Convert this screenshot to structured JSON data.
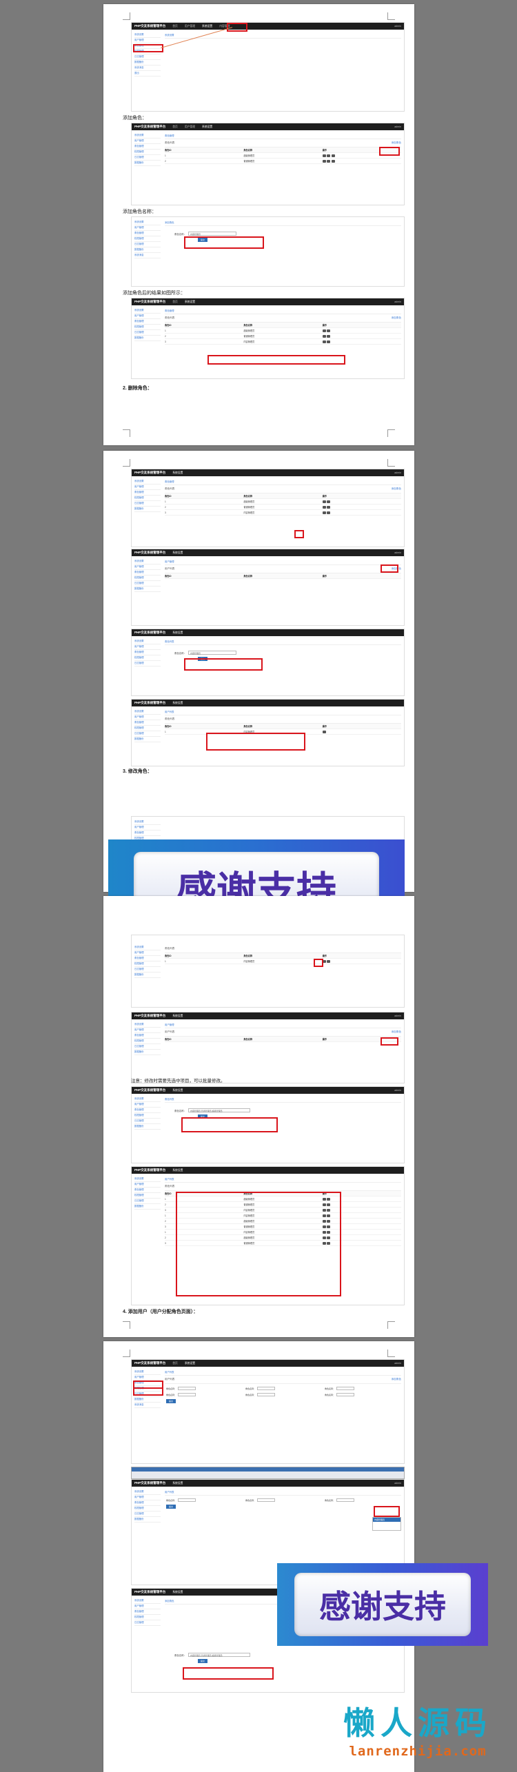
{
  "app": {
    "brand": "PHP交友系统管理平台",
    "nav": [
      "首页",
      "用户管理",
      "系统设置",
      "内容管理",
      "数据统计"
    ],
    "top_right": "admin"
  },
  "sidebar": [
    "系统设置",
    "用户管理",
    "角色管理",
    "权限管理",
    "日志管理",
    "数据备份",
    "系统消息",
    "退出"
  ],
  "table": {
    "headers": [
      "角色ID",
      "角色名称",
      "操作"
    ],
    "rows": [
      {
        "id": "1",
        "name": "超级管理员"
      },
      {
        "id": "2",
        "name": "普通管理员"
      },
      {
        "id": "3",
        "name": "内容管理员"
      }
    ]
  },
  "captions": {
    "c1": "添加角色：",
    "c2": "添加角色名称：",
    "c3": "添加角色后的结果如图所示：",
    "s2": "2.  删除角色：",
    "s3": "3.  修改角色：",
    "note": "注意：修改时需要先选中项目，可以批量修改。",
    "s4": "4.  添加用户（用户分配角色页面）："
  },
  "form": {
    "role_label": "角色名称：",
    "role_value": "内容管理员",
    "submit": "提交",
    "add_link": "添加角色",
    "list_title": "角色列表",
    "user_list": "用户列表",
    "edit_value": "内容管理员,普通管理员,超级管理员"
  },
  "overlay": {
    "thanks": "感谢支持",
    "watermark_cn": "懒人源码",
    "watermark_en": "lanrenzhijia.com"
  }
}
